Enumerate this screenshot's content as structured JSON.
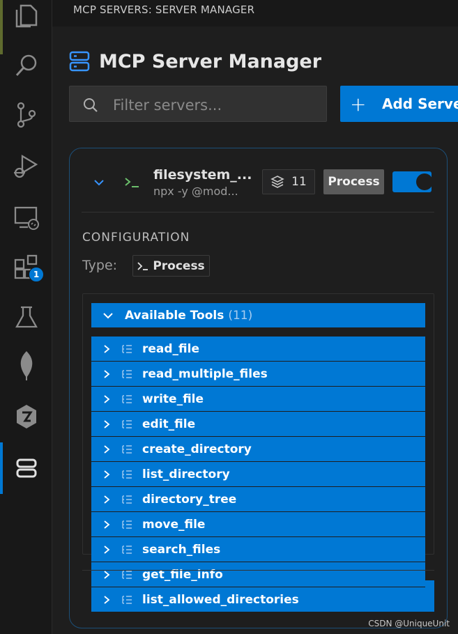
{
  "panel": {
    "header_title": "MCP SERVERS: SERVER MANAGER"
  },
  "manager": {
    "title": "MCP Server Manager"
  },
  "filter": {
    "placeholder": "Filter servers..."
  },
  "add_server": {
    "label": "Add Server"
  },
  "activity_bar": {
    "items": [
      {
        "name": "explorer-icon"
      },
      {
        "name": "search-icon"
      },
      {
        "name": "source-control-icon"
      },
      {
        "name": "run-debug-icon"
      },
      {
        "name": "remote-explorer-icon"
      },
      {
        "name": "extensions-icon",
        "badge": "1"
      },
      {
        "name": "testing-flask-icon"
      },
      {
        "name": "mongodb-leaf-icon"
      },
      {
        "name": "hexagon-extension-icon"
      },
      {
        "name": "mcp-servers-icon",
        "active": true
      }
    ]
  },
  "server": {
    "name": "filesystem_...",
    "command": "npx -y @mod...",
    "tools_count": "11",
    "type_chip": "Process",
    "enabled": true
  },
  "configuration": {
    "heading": "CONFIGURATION",
    "type_label": "Type:",
    "type_value": "Process"
  },
  "tools": {
    "header_title": "Available Tools",
    "header_count": "(11)",
    "items": [
      "read_file",
      "read_multiple_files",
      "write_file",
      "edit_file",
      "create_directory",
      "list_directory",
      "directory_tree",
      "move_file",
      "search_files",
      "get_file_info",
      "list_allowed_directories"
    ]
  },
  "watermark": "CSDN @UniqueUnit",
  "colors": {
    "accent": "#0078d4",
    "background": "#1e1e1e",
    "activity_bar": "#181818",
    "card_border": "#1c4f78"
  }
}
